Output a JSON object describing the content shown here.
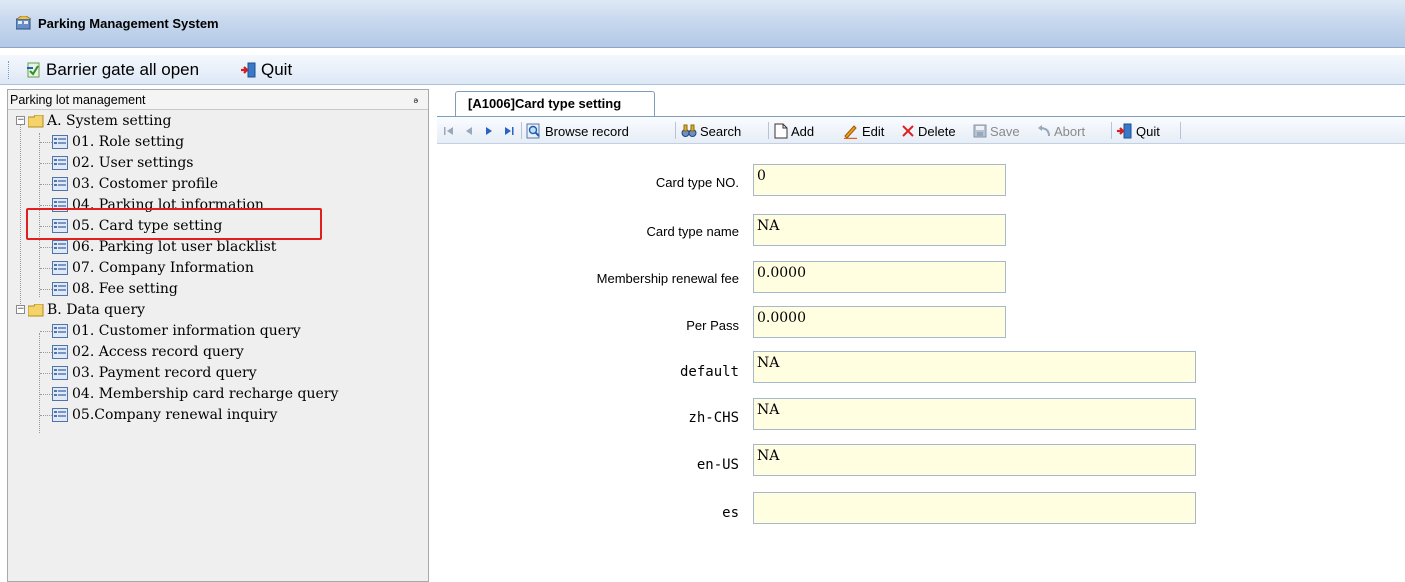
{
  "window": {
    "title": "Parking Management System"
  },
  "main_toolbar": {
    "barrier_label": "Barrier gate all open",
    "quit_label": "Quit"
  },
  "left_panel": {
    "header": "Parking lot management",
    "pin": "❑",
    "groups": [
      {
        "label": "A. System setting",
        "items": [
          "01. Role setting",
          "02. User settings",
          "03. Costomer profile",
          "04. Parking lot information",
          "05. Card type setting",
          "06. Parking lot user blacklist",
          "07. Company Information",
          "08. Fee setting"
        ]
      },
      {
        "label": "B. Data query",
        "items": [
          "01. Customer information query",
          "02. Access record query",
          "03. Payment record query",
          "04. Membership card recharge query",
          "05.Company renewal inquiry"
        ]
      }
    ]
  },
  "tab": {
    "label": "[A1006]Card type setting"
  },
  "nav_toolbar": {
    "browse_label": "Browse record",
    "search_label": "Search",
    "add_label": "Add",
    "edit_label": "Edit",
    "delete_label": "Delete",
    "save_label": "Save",
    "abort_label": "Abort",
    "quit_label": "Quit"
  },
  "form": {
    "fields": [
      {
        "label": "Card type NO.",
        "value": "0"
      },
      {
        "label": "Card type name",
        "value": "NA"
      },
      {
        "label": "Membership renewal fee",
        "value": "0.0000"
      },
      {
        "label": "Per Pass",
        "value": "0.0000"
      },
      {
        "label": "default",
        "value": "NA"
      },
      {
        "label": "zh-CHS",
        "value": "NA"
      },
      {
        "label": "en-US",
        "value": "NA"
      },
      {
        "label": "es",
        "value": ""
      }
    ]
  },
  "colors": {
    "input_bg": "#fffee0",
    "highlight": "#e0201c",
    "titlebar": "#c7d8ee"
  }
}
